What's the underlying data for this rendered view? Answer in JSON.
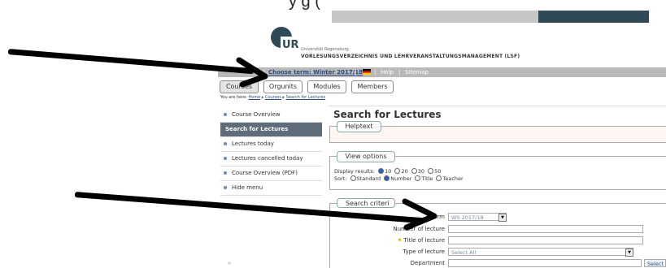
{
  "top_text": "y                                    g         (",
  "header": {
    "logo_text": "UR",
    "university": "Universität Regensburg",
    "system_name": "VORLESUNGSVERZEICHNIS UND LEHRVERANSTALTUNGSMANAGEMENT (LSF)"
  },
  "topbar": {
    "login_partial": "n",
    "choose_term": "Choose term: Winter 2017/18",
    "help": "Help",
    "sitemap": "Sitemap",
    "separator": "|"
  },
  "tabs": [
    "Courses",
    "Orgunits",
    "Modules",
    "Members"
  ],
  "breadcrumb": {
    "prefix": "You are here:",
    "items": [
      "Home",
      "Courses",
      "Search for Lectures"
    ]
  },
  "sidebar": {
    "items": [
      {
        "label": "Course Overview"
      },
      {
        "label": "Search for Lectures"
      },
      {
        "label": "Lectures today"
      },
      {
        "label": "Lectures cancelled today"
      },
      {
        "label": "Course Overview (PDF)"
      },
      {
        "label": "Hide menu"
      }
    ]
  },
  "main": {
    "title": "Search for Lectures",
    "helptext": "Helptext",
    "view_options": "View options",
    "display_results_label": "Display results:",
    "display_options": [
      "10",
      "20",
      "30",
      "50"
    ],
    "sort_label": "Sort:",
    "sort_options": [
      "Standard",
      "Number",
      "Title",
      "Teacher"
    ],
    "search_criteria": "Search criteri",
    "fields": {
      "term_label": "Term",
      "term_value": "WS 2017/18",
      "number_label": "Number of lecture",
      "title_label": "Title of lecture",
      "type_label": "Type of lecture",
      "type_value": "Select All",
      "department_label": "Department",
      "select_button": "Select"
    }
  },
  "colors": {
    "banner_dark": "#2f4a56",
    "topbar": "#b9b9b9",
    "sidebar_active": "#5f6d7a",
    "link": "#2a4c7e"
  }
}
